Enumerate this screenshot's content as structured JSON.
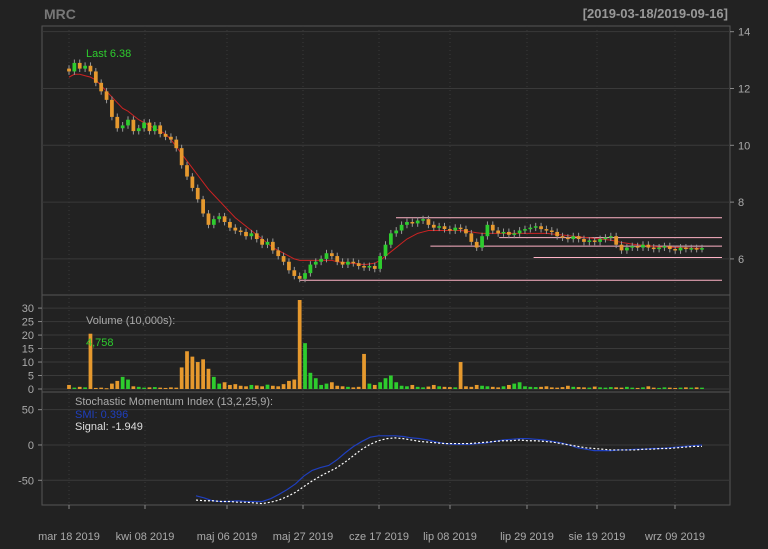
{
  "header": {
    "title": "MRC",
    "date_range": "[2019-03-18/2019-09-16]"
  },
  "colors": {
    "up": "#2ecc2e",
    "down": "#e6992e",
    "sma": "#cc2222",
    "level": "#ffb3c6",
    "smi": "#1f3fbf",
    "signal": "#ffffff",
    "grid": "#3a3a3a",
    "background": "#222222"
  },
  "chart_data": [
    {
      "type": "candlestick",
      "title": "MRC",
      "annotation": "Last 6.38",
      "ylim": [
        4.8,
        14.2
      ],
      "yticks": [
        "6",
        "8",
        "10",
        "12",
        "14"
      ],
      "xticks": [
        "mar 18 2019",
        "kwi 08 2019",
        "maj 06 2019",
        "maj 27 2019",
        "cze 17 2019",
        "lip 08 2019",
        "lip 29 2019",
        "sie 19 2019",
        "wrz 09 2019"
      ],
      "closes": [
        12.6,
        12.9,
        12.7,
        12.8,
        12.6,
        12.2,
        11.9,
        11.6,
        11.0,
        10.6,
        10.7,
        10.9,
        10.5,
        10.6,
        10.8,
        10.5,
        10.7,
        10.4,
        10.3,
        10.2,
        9.9,
        9.3,
        8.9,
        8.5,
        8.1,
        7.6,
        7.2,
        7.4,
        7.5,
        7.3,
        7.1,
        7.0,
        6.95,
        6.8,
        6.9,
        6.7,
        6.5,
        6.6,
        6.3,
        6.1,
        5.9,
        5.6,
        5.4,
        5.3,
        5.5,
        5.8,
        5.9,
        6.0,
        6.2,
        6.1,
        5.9,
        5.8,
        5.9,
        5.85,
        5.75,
        5.7,
        5.75,
        5.65,
        6.1,
        6.5,
        6.9,
        7.0,
        7.2,
        7.3,
        7.25,
        7.35,
        7.4,
        7.2,
        7.1,
        7.15,
        7.05,
        7.0,
        7.1,
        7.05,
        6.9,
        6.6,
        6.4,
        6.8,
        7.2,
        7.0,
        6.9,
        6.95,
        6.85,
        6.9,
        7.0,
        7.05,
        7.1,
        7.15,
        7.05,
        7.0,
        6.95,
        6.8,
        6.75,
        6.7,
        6.8,
        6.7,
        6.6,
        6.65,
        6.6,
        6.7,
        6.75,
        6.8,
        6.5,
        6.3,
        6.4,
        6.45,
        6.4,
        6.5,
        6.4,
        6.35,
        6.4,
        6.45,
        6.35,
        6.3,
        6.4,
        6.35,
        6.38,
        6.35,
        6.38
      ],
      "sma": [
        12.4,
        12.5,
        12.5,
        12.45,
        12.4,
        12.3,
        12.1,
        11.9,
        11.7,
        11.5,
        11.3,
        11.2,
        11.05,
        10.9,
        10.8,
        10.7,
        10.6,
        10.5,
        10.4,
        10.2,
        9.95,
        9.7,
        9.45,
        9.2,
        8.95,
        8.7,
        8.45,
        8.25,
        8.05,
        7.85,
        7.65,
        7.45,
        7.3,
        7.15,
        7.0,
        6.85,
        6.7,
        6.55,
        6.4,
        6.3,
        6.2,
        6.1,
        6.0,
        5.95,
        5.95,
        5.95,
        5.95,
        5.95,
        5.95,
        5.95,
        5.9,
        5.88,
        5.86,
        5.84,
        5.82,
        5.8,
        5.82,
        5.85,
        5.95,
        6.1,
        6.25,
        6.4,
        6.55,
        6.7,
        6.8,
        6.9,
        6.95,
        7.0,
        7.0,
        7.0,
        7.0,
        7.0,
        7.0,
        7.0,
        6.98,
        6.95,
        6.92,
        6.9,
        6.9,
        6.9,
        6.9,
        6.9,
        6.9,
        6.9,
        6.9,
        6.9,
        6.9,
        6.9,
        6.9,
        6.9,
        6.88,
        6.86,
        6.84,
        6.82,
        6.8,
        6.78,
        6.76,
        6.74,
        6.72,
        6.7,
        6.68,
        6.66,
        6.62,
        6.58,
        6.55,
        6.52,
        6.5,
        6.48,
        6.46,
        6.44,
        6.42,
        6.42,
        6.41,
        6.4,
        6.4,
        6.39,
        6.38,
        6.38,
        6.38
      ],
      "levels": [
        {
          "value": 7.45,
          "from": 0.5,
          "to": 1.0
        },
        {
          "value": 6.75,
          "from": 0.65,
          "to": 1.0
        },
        {
          "value": 6.45,
          "from": 0.55,
          "to": 1.0
        },
        {
          "value": 6.05,
          "from": 0.7,
          "to": 1.0
        },
        {
          "value": 5.25,
          "from": 0.36,
          "to": 1.0
        }
      ]
    },
    {
      "type": "bar",
      "title": "Volume (10,000s):",
      "annotation": "4,758",
      "ylim": [
        0,
        33
      ],
      "yticks": [
        "0",
        "5",
        "10",
        "15",
        "20",
        "25",
        "30"
      ],
      "values": [
        1.5,
        0.5,
        0.8,
        0.6,
        20.5,
        0.4,
        0.5,
        0.3,
        2.0,
        3.0,
        4.5,
        3.5,
        1.0,
        0.8,
        0.5,
        0.6,
        0.7,
        0.5,
        0.4,
        0.6,
        0.5,
        8.0,
        14.0,
        12.0,
        10.0,
        11.0,
        7.5,
        4.5,
        2.0,
        2.5,
        1.5,
        1.8,
        1.2,
        1.0,
        1.5,
        1.3,
        1.0,
        1.6,
        1.2,
        1.0,
        1.8,
        3.0,
        3.5,
        33.0,
        17.0,
        6.0,
        4.0,
        1.5,
        2.0,
        2.5,
        1.2,
        1.0,
        0.8,
        0.6,
        0.8,
        13.0,
        2.0,
        1.5,
        2.5,
        4.0,
        5.0,
        2.5,
        1.2,
        1.0,
        1.5,
        0.8,
        0.6,
        0.9,
        1.5,
        1.0,
        0.8,
        0.7,
        0.6,
        10.0,
        1.0,
        0.8,
        1.5,
        1.2,
        1.0,
        0.8,
        0.6,
        1.0,
        1.5,
        2.0,
        2.5,
        1.0,
        0.8,
        0.7,
        0.8,
        1.0,
        0.6,
        0.5,
        0.7,
        1.2,
        0.8,
        0.7,
        0.6,
        0.5,
        0.9,
        0.6,
        0.5,
        0.7,
        0.6,
        0.5,
        0.8,
        0.5,
        0.4,
        0.6,
        1.0,
        0.5,
        0.4,
        0.6,
        0.5,
        0.4,
        0.5,
        0.6,
        0.5,
        0.6,
        0.5
      ]
    },
    {
      "type": "line",
      "title": "Stochastic Momentum Index (13,2,25,9):",
      "smi_label": "SMI: 0.396",
      "signal_label": "Signal: -1.949",
      "ylim": [
        -85,
        75
      ],
      "yticks": [
        "-50",
        "0",
        "50"
      ],
      "series": [
        {
          "name": "SMI",
          "values": [
            -72,
            -75,
            -79,
            -80,
            -80,
            -79,
            -80,
            -80,
            -80,
            -76,
            -70,
            -63,
            -55,
            -44,
            -36,
            -32,
            -29,
            -21,
            -11,
            -2,
            5,
            11,
            13,
            13,
            13,
            12,
            10,
            9,
            7,
            4,
            2,
            1,
            1,
            1,
            2,
            3,
            5,
            7,
            8,
            9,
            9,
            8,
            7,
            5,
            3,
            0,
            -4,
            -6,
            -8,
            -8,
            -8,
            -7,
            -7,
            -6,
            -6,
            -5,
            -5,
            -4,
            -3,
            -2,
            -1,
            0
          ]
        },
        {
          "name": "Signal",
          "values": [
            -78,
            -79,
            -79,
            -80,
            -80,
            -81,
            -81,
            -82,
            -83,
            -81,
            -78,
            -73,
            -67,
            -59,
            -51,
            -44,
            -38,
            -32,
            -24,
            -15,
            -6,
            1,
            6,
            9,
            10,
            9,
            7,
            5,
            4,
            3,
            2,
            2,
            2,
            2,
            3,
            4,
            5,
            6,
            6,
            7,
            6,
            6,
            5,
            4,
            2,
            0,
            -2,
            -4,
            -5,
            -6,
            -7,
            -7,
            -7,
            -7,
            -6,
            -6,
            -5,
            -5,
            -4,
            -3,
            -2,
            -2
          ]
        }
      ]
    }
  ]
}
